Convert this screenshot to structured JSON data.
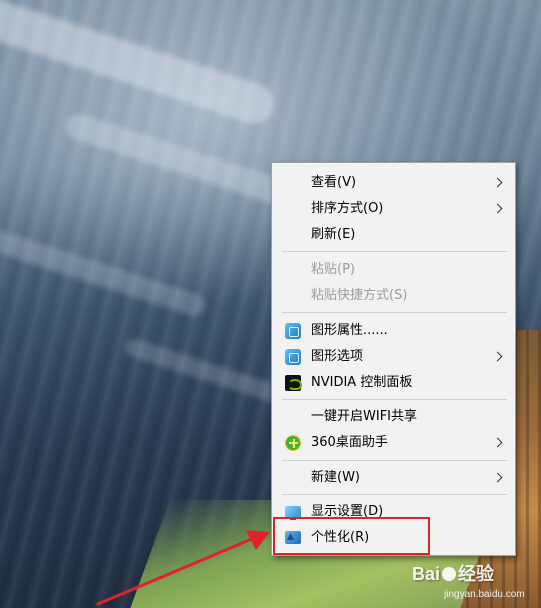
{
  "context_menu": {
    "items": [
      {
        "label": "查看(V)",
        "enabled": true,
        "submenu": true,
        "icon": null
      },
      {
        "label": "排序方式(O)",
        "enabled": true,
        "submenu": true,
        "icon": null
      },
      {
        "label": "刷新(E)",
        "enabled": true,
        "submenu": false,
        "icon": null
      },
      {
        "label": "粘贴(P)",
        "enabled": false,
        "submenu": false,
        "icon": null
      },
      {
        "label": "粘贴快捷方式(S)",
        "enabled": false,
        "submenu": false,
        "icon": null
      },
      {
        "label": "图形属性......",
        "enabled": true,
        "submenu": false,
        "icon": "intel-graphics-icon"
      },
      {
        "label": "图形选项",
        "enabled": true,
        "submenu": true,
        "icon": "intel-graphics-icon"
      },
      {
        "label": "NVIDIA 控制面板",
        "enabled": true,
        "submenu": false,
        "icon": "nvidia-icon"
      },
      {
        "label": "一键开启WIFI共享",
        "enabled": true,
        "submenu": false,
        "icon": null
      },
      {
        "label": "360桌面助手",
        "enabled": true,
        "submenu": true,
        "icon": "360-icon"
      },
      {
        "label": "新建(W)",
        "enabled": true,
        "submenu": true,
        "icon": null
      },
      {
        "label": "显示设置(D)",
        "enabled": true,
        "submenu": false,
        "icon": "display-settings-icon"
      },
      {
        "label": "个性化(R)",
        "enabled": true,
        "submenu": false,
        "icon": "personalize-icon"
      }
    ]
  },
  "annotation": {
    "highlight_color": "#e0232a",
    "highlighted_item": "个性化(R)"
  },
  "watermark": {
    "text_left": "Bai",
    "text_right": "经验",
    "url": "jingyan.baidu.com"
  }
}
